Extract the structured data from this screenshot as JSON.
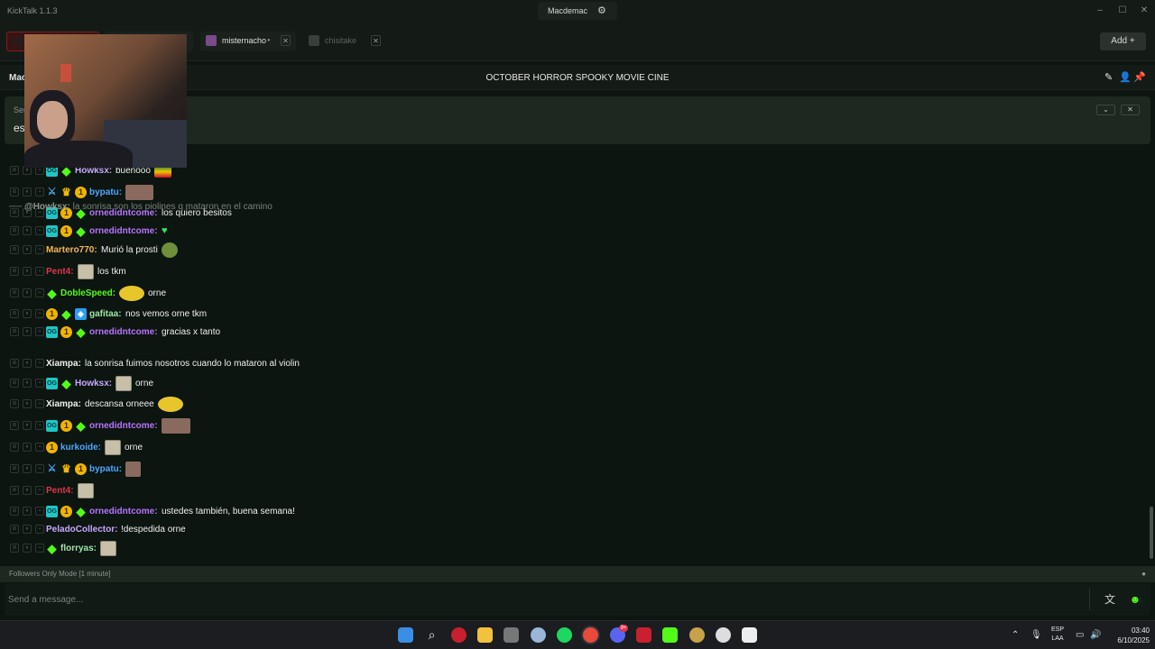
{
  "window": {
    "app_title": "KickTalk 1.1.3",
    "center_user": "Macdemac",
    "minimize": "–",
    "maximize": "☐",
    "close": "✕"
  },
  "tabs": [
    {
      "label": "",
      "active": true
    },
    {
      "label": "",
      "active": false
    },
    {
      "label": "misternacho",
      "live_dot": "●"
    },
    {
      "label": "chisitake"
    }
  ],
  "add_button": "Add +",
  "channel": {
    "name": "Mac",
    "stream_title": "OCTOBER HORROR SPOOKY MOVIE CINE"
  },
  "pinned": {
    "title": "Sen",
    "text": "es"
  },
  "reply": {
    "user": "@Howksx:",
    "text": "la sonrisa son los piolines q mataron en el camino"
  },
  "messages": [
    {
      "user": "Howksx:",
      "color": "#c9a7ff",
      "text": "buenooo",
      "badges": [
        "og",
        "kick"
      ]
    },
    {
      "user": "bypatu:",
      "color": "#4fa6ff",
      "text": "",
      "badges": [
        "sword",
        "crown",
        "sub"
      ]
    },
    {
      "user": "ornedidntcome:",
      "color": "#b873ff",
      "text": "los quiero besitos",
      "badges": [
        "og",
        "sub",
        "kick"
      ]
    },
    {
      "user": "ornedidntcome:",
      "color": "#b873ff",
      "text": "",
      "badges": [
        "og",
        "sub",
        "kick"
      ]
    },
    {
      "user": "Martero770:",
      "color": "#f5b45a",
      "text": "Murió la prosti",
      "badges": []
    },
    {
      "user": "Pent4:",
      "color": "#e0354b",
      "text": "los tkm",
      "badges": []
    },
    {
      "user": "DobleSpeed:",
      "color": "#53fc18",
      "text": "orne",
      "badges": [
        "kick"
      ]
    },
    {
      "user": "gafitaa:",
      "color": "#9fe4a8",
      "text": "nos vemos orne tkm",
      "badges": [
        "sub",
        "kick",
        "gem"
      ]
    },
    {
      "user": "ornedidntcome:",
      "color": "#b873ff",
      "text": "gracias x tanto",
      "badges": [
        "og",
        "sub",
        "kick"
      ]
    },
    {
      "user": "Xiampa:",
      "color": "#f0f0f0",
      "text": "la sonrisa fuimos nosotros cuando lo mataron al violin",
      "badges": []
    },
    {
      "user": "Howksx:",
      "color": "#c9a7ff",
      "text": "orne",
      "badges": [
        "og",
        "kick"
      ]
    },
    {
      "user": "Xiampa:",
      "color": "#f0f0f0",
      "text": "descansa orneee",
      "badges": []
    },
    {
      "user": "ornedidntcome:",
      "color": "#b873ff",
      "text": "",
      "badges": [
        "og",
        "sub",
        "kick"
      ]
    },
    {
      "user": "kurkoide:",
      "color": "#4fa6ff",
      "text": "orne",
      "badges": [
        "sub"
      ]
    },
    {
      "user": "bypatu:",
      "color": "#4fa6ff",
      "text": "",
      "badges": [
        "sword",
        "crown",
        "sub"
      ]
    },
    {
      "user": "Pent4:",
      "color": "#e0354b",
      "text": "",
      "badges": []
    },
    {
      "user": "ornedidntcome:",
      "color": "#b873ff",
      "text": "ustedes también, buena semana!",
      "badges": [
        "og",
        "sub",
        "kick"
      ]
    },
    {
      "user": "PeladoCollector:",
      "color": "#c9a7ff",
      "text": "!despedida orne",
      "badges": []
    },
    {
      "user": "florryas:",
      "color": "#9fe4a8",
      "text": "",
      "badges": [
        "kick"
      ]
    }
  ],
  "followers_only": "Followers Only Mode [1 minute]",
  "composer": {
    "placeholder": "Send a message..."
  },
  "taskbar": {
    "lang_top": "ESP",
    "lang_bottom": "LAA",
    "time": "03:40",
    "date": "6/10/2025",
    "discord_badge": "9+"
  }
}
